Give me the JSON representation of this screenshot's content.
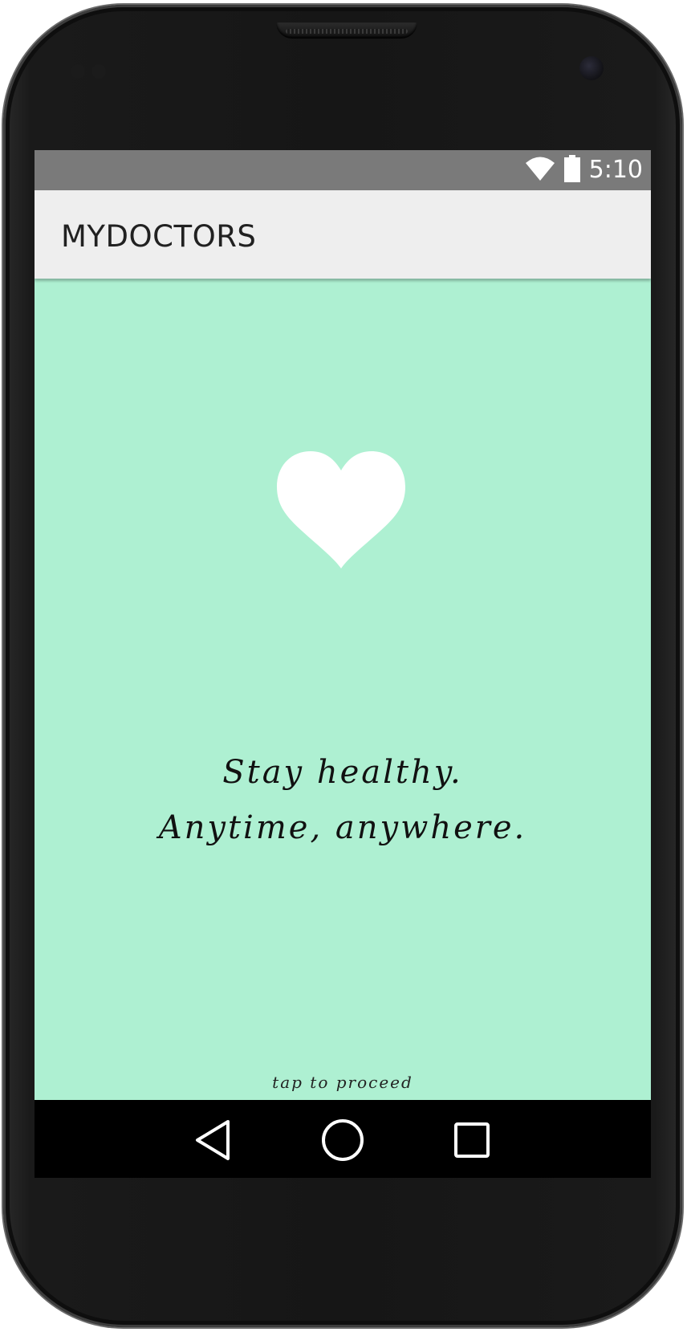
{
  "status_bar": {
    "time": "5:10",
    "icons": [
      "wifi-icon",
      "battery-icon"
    ]
  },
  "app_bar": {
    "title": "MYDOCTORS"
  },
  "splash": {
    "logo_icon": "heart-icon",
    "tagline_line1": "Stay healthy.",
    "tagline_line2": "Anytime, anywhere.",
    "tap_hint": "tap to proceed"
  },
  "nav_bar": {
    "buttons": [
      "back-icon",
      "home-icon",
      "recents-icon"
    ]
  },
  "colors": {
    "background": "#aef0d2",
    "app_bar": "#eeeeee",
    "status_bar": "#7a7a7a",
    "nav_bar": "#000000",
    "heart": "#ffffff"
  }
}
